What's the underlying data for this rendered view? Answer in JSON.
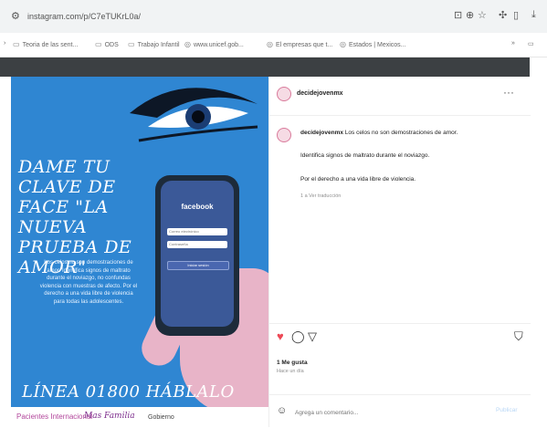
{
  "browser": {
    "url": "instagram.com/p/C7eTUKrL0a/",
    "site_info_icon": "tune-icon",
    "toolbar_icons": [
      "translate-icon",
      "zoom-icon",
      "star-icon",
      "extension-icon",
      "sidepanel-icon"
    ],
    "bookmarks": [
      {
        "label": "Teoria de las sent...",
        "icon": "folder-icon"
      },
      {
        "label": "ODS",
        "icon": "folder-icon"
      },
      {
        "label": "Trabajo Infantil",
        "icon": "folder-icon"
      },
      {
        "label": "www.unicef.gob...",
        "icon": "globe-icon"
      },
      {
        "label": "El empresas que t...",
        "icon": "globe-icon"
      },
      {
        "label": "Estados | Mexicos...",
        "icon": "globe-icon"
      }
    ],
    "bookmarks_overflow": "»",
    "all_bookmarks_icon": "folder-icon"
  },
  "post_image": {
    "headline": "DAME TU CLAVE DE FACE \"LA NUEVA PRUEBA DE AMOR\"",
    "phone_brand": "facebook",
    "phone_field_1": "Correo electrónico",
    "phone_field_2": "Contraseña",
    "phone_button": "Iniciar sesión",
    "body_copy": "Los celos no son demostraciones de amor. Identifica signos de maltrato durante el noviazgo, no confundas violencia con muestras de afecto. Por el derecho a una vida libre de violencia para todas las adolescentes.",
    "footer": "LÍNEA 01800 HÁBLALO",
    "logo_1": "Pacientes Internacional",
    "logo_2": "Mas Familia",
    "logo_3": "Gobierno"
  },
  "panel": {
    "username": "decidejovenmx",
    "more_icon": "more-icon",
    "caption_user": "decidejovenmx",
    "caption_line_1": "Los celos no son demostraciones de amor.",
    "caption_line_2": "Identifica signos de maltrato durante el noviazgo.",
    "caption_line_3": "Por el derecho a una vida libre de violencia.",
    "caption_meta": "1 a   Ver traducción",
    "likes": "1 Me gusta",
    "date": "Hace un día",
    "comment_placeholder": "Agrega un comentario...",
    "post_label": "Publicar",
    "colors": {
      "like": "#ed4956",
      "link": "#0095f6",
      "background": "#2f86d2"
    }
  }
}
